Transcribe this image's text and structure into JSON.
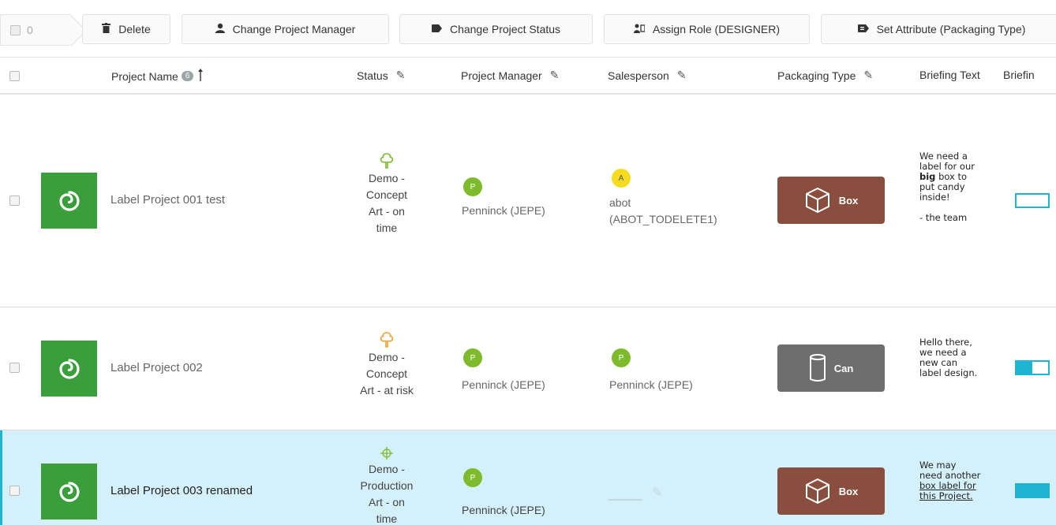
{
  "toolbar": {
    "selected_count": "0",
    "buttons": [
      {
        "label": "Delete",
        "icon": "trash-icon"
      },
      {
        "label": "Change Project Manager",
        "icon": "user-icon"
      },
      {
        "label": "Change Project Status",
        "icon": "tag-icon"
      },
      {
        "label": "Assign Role (DESIGNER)",
        "icon": "assign-role-icon"
      },
      {
        "label": "Set Attribute (Packaging Type)",
        "icon": "attribute-icon"
      }
    ]
  },
  "table": {
    "columns": {
      "project_name": "Project Name",
      "project_count": "6",
      "status": "Status",
      "project_manager": "Project Manager",
      "salesperson": "Salesperson",
      "packaging_type": "Packaging Type",
      "briefing_text": "Briefing Text",
      "briefing_cut": "Briefin"
    },
    "rows": [
      {
        "name": "Label Project 001 test",
        "status_lines": [
          "Demo -",
          "Concept",
          "Art - on",
          "time"
        ],
        "manager_initial": "P",
        "manager": "Penninck (JEPE)",
        "sales_initial": "A",
        "sales_line1": "abot",
        "sales_line2": "(ABOT_TODELETE1)",
        "packaging": "Box",
        "brief_lines": [
          "We need a",
          "label for our",
          "box to",
          "put candy",
          "inside!",
          "- the team"
        ],
        "brief_bold": "big"
      },
      {
        "name": "Label Project 002",
        "status_lines": [
          "Demo -",
          "Concept",
          "Art - at risk"
        ],
        "manager_initial": "P",
        "manager": "Penninck (JEPE)",
        "sales_initial": "P",
        "sales_line1": "Penninck (JEPE)",
        "packaging": "Can",
        "brief_lines": [
          "Hello there,",
          "we need a",
          "new can",
          "label design."
        ]
      },
      {
        "name": "Label Project 003 renamed",
        "status_lines": [
          "Demo -",
          "Production",
          "Art - on",
          "time"
        ],
        "manager_initial": "P",
        "manager": "Penninck (JEPE)",
        "packaging": "Box",
        "brief_lines": [
          "We may",
          "need another"
        ],
        "brief_link_lines": [
          "box label for",
          "this Project."
        ]
      }
    ]
  },
  "colors": {
    "accent": "#1fb4d2",
    "thumb_green": "#3a9e3a",
    "avatar_green": "#7dbb2c",
    "avatar_yellow": "#f5dc1e",
    "box_brown": "#8a4e3e",
    "can_gray": "#6e6e6e",
    "status_on_time": "#7dbb2c",
    "status_at_risk": "#f0a030"
  }
}
